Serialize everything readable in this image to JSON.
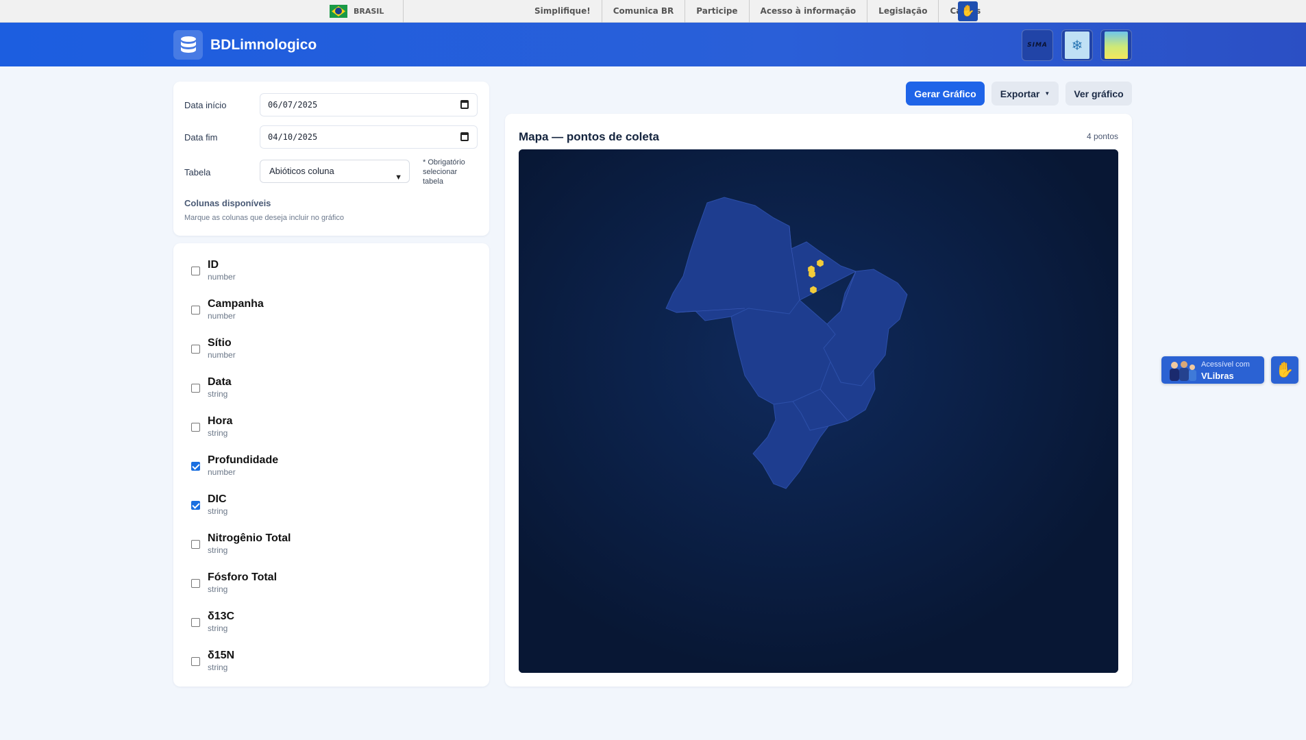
{
  "gov_bar": {
    "country": "BRASIL",
    "links": [
      "Simplifique!",
      "Comunica BR",
      "Participe",
      "Acesso à informação",
      "Legislação",
      "Canais"
    ]
  },
  "header": {
    "title": "BDLimnologico",
    "partners": [
      "SIMA"
    ]
  },
  "filters": {
    "start_label": "Data início",
    "start_value": "06/07/2025",
    "end_label": "Data fim",
    "end_value": "04/10/2025",
    "table_label": "Tabela",
    "table_value": "Abióticos coluna",
    "required_note": "* Obrigatório selecionar tabela",
    "columns_title": "Colunas disponíveis",
    "columns_subtitle": "Marque as colunas que deseja incluir no gráfico"
  },
  "columns": [
    {
      "name": "ID",
      "type": "number",
      "checked": false
    },
    {
      "name": "Campanha",
      "type": "number",
      "checked": false
    },
    {
      "name": "Sítio",
      "type": "number",
      "checked": false
    },
    {
      "name": "Data",
      "type": "string",
      "checked": false
    },
    {
      "name": "Hora",
      "type": "string",
      "checked": false
    },
    {
      "name": "Profundidade",
      "type": "number",
      "checked": true
    },
    {
      "name": "DIC",
      "type": "string",
      "checked": true
    },
    {
      "name": "Nitrogênio Total",
      "type": "string",
      "checked": false
    },
    {
      "name": "Fósforo Total",
      "type": "string",
      "checked": false
    },
    {
      "name": "δ13C",
      "type": "string",
      "checked": false
    },
    {
      "name": "δ15N",
      "type": "string",
      "checked": false
    }
  ],
  "toolbar": {
    "generate": "Gerar Gráfico",
    "export": "Exportar",
    "view": "Ver gráfico"
  },
  "map": {
    "title": "Mapa — pontos de coleta",
    "count": "4 pontos",
    "point_color": "#f2cc3a",
    "region_color": "#1e3d8f"
  },
  "vlibras": {
    "small": "Acessível com",
    "big": "VLibras"
  },
  "colors": {
    "header": "#1c5ee0",
    "primary_button": "#1f64e8",
    "map_background": "#081734"
  }
}
